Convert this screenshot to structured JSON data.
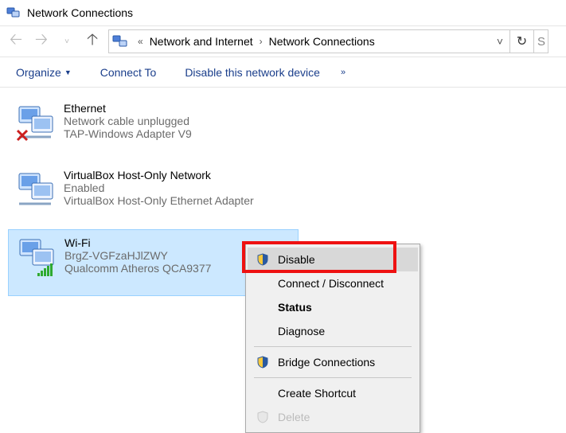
{
  "window": {
    "title": "Network Connections"
  },
  "breadcrumb": {
    "seg1": "Network and Internet",
    "seg2": "Network Connections"
  },
  "toolbar": {
    "organize": "Organize",
    "connect_to": "Connect To",
    "disable": "Disable this network device",
    "overflow": "»"
  },
  "adapters": [
    {
      "name": "Ethernet",
      "status": "Network cable unplugged",
      "device": "TAP-Windows Adapter V9",
      "kind": "ethernet-unplugged",
      "selected": false
    },
    {
      "name": "VirtualBox Host-Only Network",
      "status": "Enabled",
      "device": "VirtualBox Host-Only Ethernet Adapter",
      "kind": "ethernet",
      "selected": false
    },
    {
      "name": "Wi-Fi",
      "status": "BrgZ-VGFzaHJlZWY",
      "device": "Qualcomm Atheros QCA9377",
      "kind": "wifi",
      "selected": true
    }
  ],
  "context_menu": {
    "disable": "Disable",
    "connect": "Connect / Disconnect",
    "status": "Status",
    "diagnose": "Diagnose",
    "bridge": "Bridge Connections",
    "shortcut": "Create Shortcut",
    "delete": "Delete"
  }
}
